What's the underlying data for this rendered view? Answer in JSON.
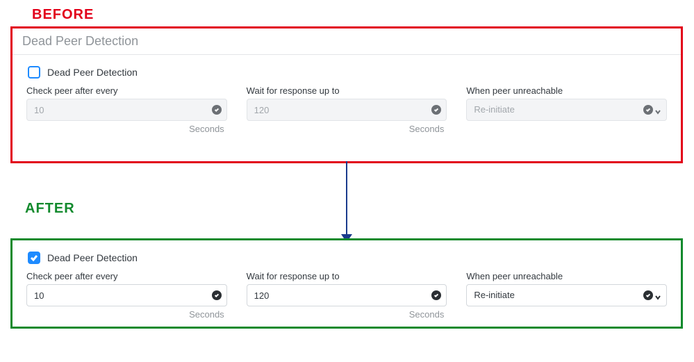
{
  "labels": {
    "before": "BEFORE",
    "after": "AFTER"
  },
  "before": {
    "section_title": "Dead Peer Detection",
    "checkbox_label": "Dead Peer Detection",
    "checked": false,
    "fields": {
      "check_peer": {
        "label": "Check peer after every",
        "value": "10",
        "unit": "Seconds"
      },
      "wait_resp": {
        "label": "Wait for response up to",
        "value": "120",
        "unit": "Seconds"
      },
      "unreachable": {
        "label": "When peer unreachable",
        "value": "Re-initiate"
      }
    }
  },
  "after": {
    "checkbox_label": "Dead Peer Detection",
    "checked": true,
    "fields": {
      "check_peer": {
        "label": "Check peer after every",
        "value": "10",
        "unit": "Seconds"
      },
      "wait_resp": {
        "label": "Wait for response up to",
        "value": "120",
        "unit": "Seconds"
      },
      "unreachable": {
        "label": "When peer unreachable",
        "value": "Re-initiate"
      }
    }
  }
}
